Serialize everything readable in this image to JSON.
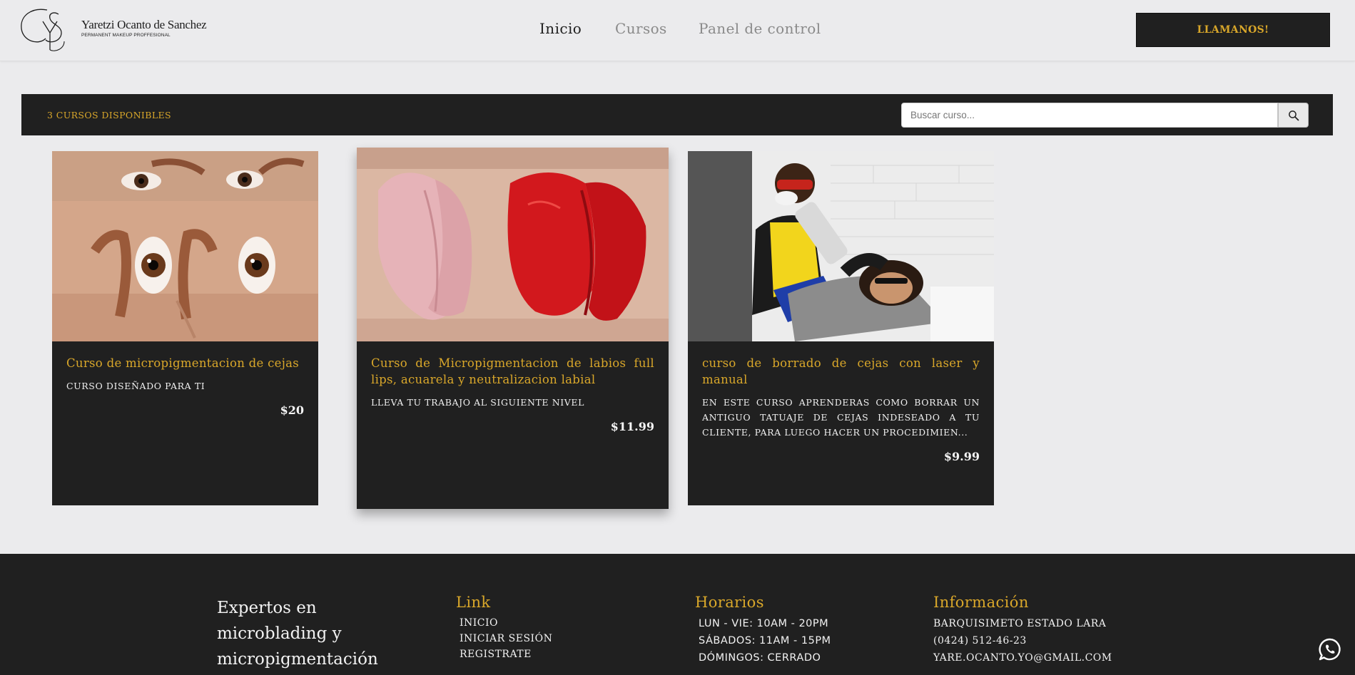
{
  "header": {
    "logo_monogram": "YS",
    "logo_name": "Yaretzi Ocanto de Sanchez",
    "logo_subtitle": "PERMANENT MAKEUP PROFFESIONAL",
    "nav": [
      {
        "label": "Inicio",
        "active": true
      },
      {
        "label": "Cursos",
        "active": false
      },
      {
        "label": "Panel de control",
        "active": false
      }
    ],
    "cta_label": "LLAMANOS!"
  },
  "toolbar": {
    "count_label": "3 CURSOS DISPONIBLES",
    "search": {
      "placeholder": "Buscar curso...",
      "value": ""
    },
    "search_icon": "magnifier-icon"
  },
  "courses": [
    {
      "title": "Curso de micropigmentacion de cejas",
      "description": "CURSO DISEÑADO PARA TI",
      "price": "$20",
      "image": "eyebrows-photo"
    },
    {
      "title": "Curso de Micropigmentacion de labios full lips, acuarela y neutralizacion labial",
      "description": "LLEVA TU TRABAJO AL SIGUIENTE NIVEL",
      "price": "$11.99",
      "image": "lips-before-after-photo"
    },
    {
      "title": "curso de borrado de cejas con laser y manual",
      "description": "EN ESTE CURSO APRENDERAS COMO BORRAR UN ANTIGUO TATUAJE DE CEJAS INDESEADO A TU CLIENTE, PARA LUEGO HACER UN PROCEDIMIEN...",
      "price": "$9.99",
      "image": "laser-removal-photo"
    }
  ],
  "footer": {
    "tagline": "Expertos en microblading y micropigmentación",
    "link": {
      "title": "Link",
      "items": [
        "INICIO",
        "INICIAR SESIÓN",
        "REGISTRATE"
      ]
    },
    "hours": {
      "title": "Horarios",
      "items": [
        "LUN - VIE: 10AM - 20PM",
        "SÁBADOS: 11AM - 15PM",
        "DÓMINGOS: CERRADO"
      ]
    },
    "info": {
      "title": "Información",
      "items": [
        "BARQUISIMETO ESTADO LARA",
        "(0424) 512-46-23",
        "YARE.OCANTO.YO@GMAIL.COM"
      ]
    },
    "whatsapp_icon": "whatsapp-icon"
  },
  "colors": {
    "dark": "#202020",
    "gold": "#d9a72a",
    "background": "#ebebed",
    "muted_nav": "#8a8a8a"
  }
}
